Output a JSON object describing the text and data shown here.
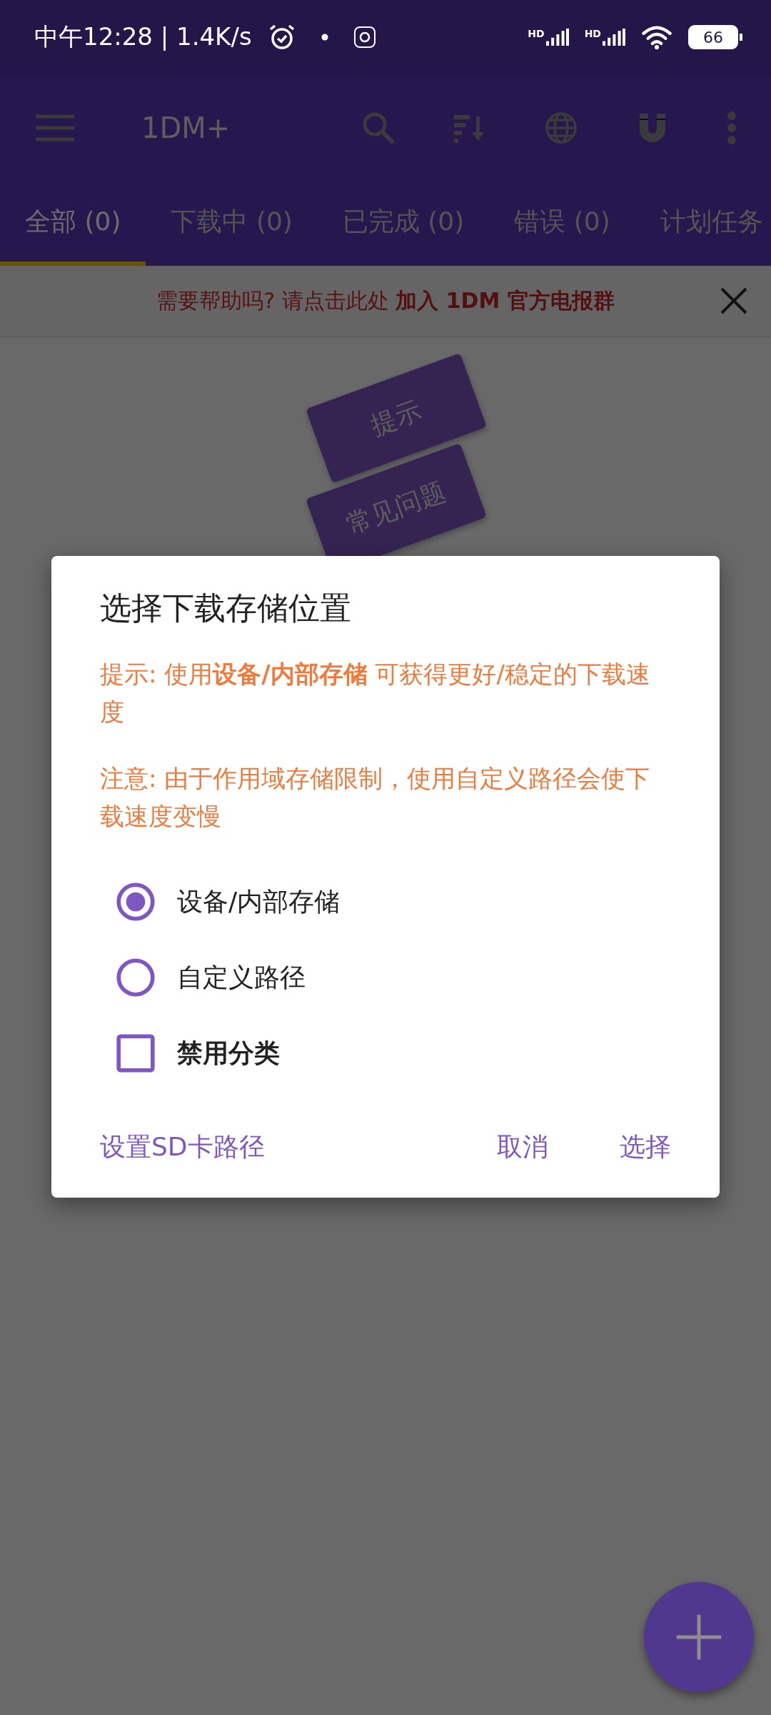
{
  "status_bar": {
    "time": "中午12:28 | 1.4K/s",
    "signal_labels": [
      "HD",
      "HD"
    ],
    "battery": "66"
  },
  "toolbar": {
    "title": "1DM+"
  },
  "tabs": [
    {
      "label": "全部 (0)",
      "selected": true
    },
    {
      "label": "下载中 (0)",
      "selected": false
    },
    {
      "label": "已完成 (0)",
      "selected": false
    },
    {
      "label": "错误 (0)",
      "selected": false
    },
    {
      "label": "计划任务",
      "selected": false
    }
  ],
  "banner": {
    "text": "需要帮助吗? 请点击此处 **加入 1DM 官方电报群**"
  },
  "help_buttons": [
    "提示",
    "常见问题"
  ],
  "dialog": {
    "title": "选择下载存储位置",
    "notes": [
      "提示: 使用**设备/内部存储** 可获得更好/稳定的下载速度",
      "注意: 由于作用域存储限制，使用自定义路径会使下载速度变慢"
    ],
    "options": [
      {
        "kind": "radio",
        "label": "设备/内部存储",
        "selected": true
      },
      {
        "kind": "radio",
        "label": "自定义路径",
        "selected": false
      },
      {
        "kind": "checkbox",
        "label": "禁用分类",
        "checked": false
      }
    ],
    "neutral_button": "设置SD卡路径",
    "buttons": [
      "取消",
      "选择"
    ]
  }
}
